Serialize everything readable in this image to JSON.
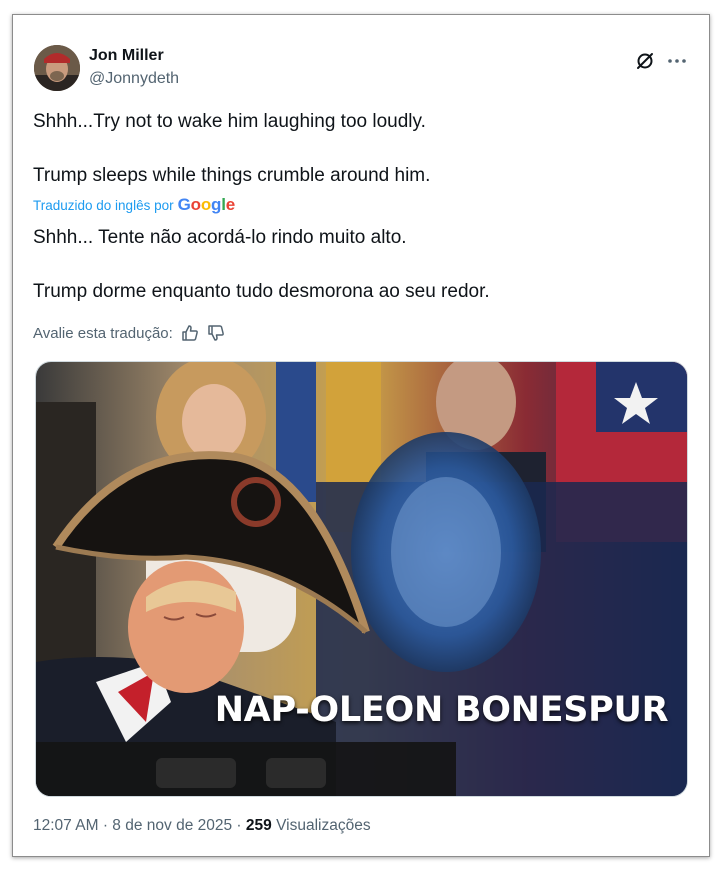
{
  "author": {
    "name": "Jon Miller",
    "handle": "@Jonnydeth"
  },
  "icons": {
    "grok": "grok-icon",
    "more": "more-options-icon",
    "thumbs_up": "thumbs-up-icon",
    "thumbs_down": "thumbs-down-icon"
  },
  "tweet": {
    "original_line1": "Shhh...Try not to wake him laughing too loudly.",
    "original_line2": "Trump sleeps while things crumble around him.",
    "translated_by": "Traduzido do inglês por",
    "translation_provider": "Google",
    "translated_line1": "Shhh... Tente não acordá-lo rindo muito alto.",
    "translated_line2": "Trump dorme enquanto tudo desmorona ao seu redor.",
    "rate_translation": "Avalie esta tradução:"
  },
  "media": {
    "caption": "NAP-OLEON BONESPUR"
  },
  "meta": {
    "time": "12:07 AM",
    "separator": "·",
    "date": "8 de nov de 2025",
    "views_count": "259",
    "views_label": "Visualizações"
  },
  "colors": {
    "accent": "#1d9bf0",
    "text": "#0f1419",
    "secondary": "#536471"
  }
}
